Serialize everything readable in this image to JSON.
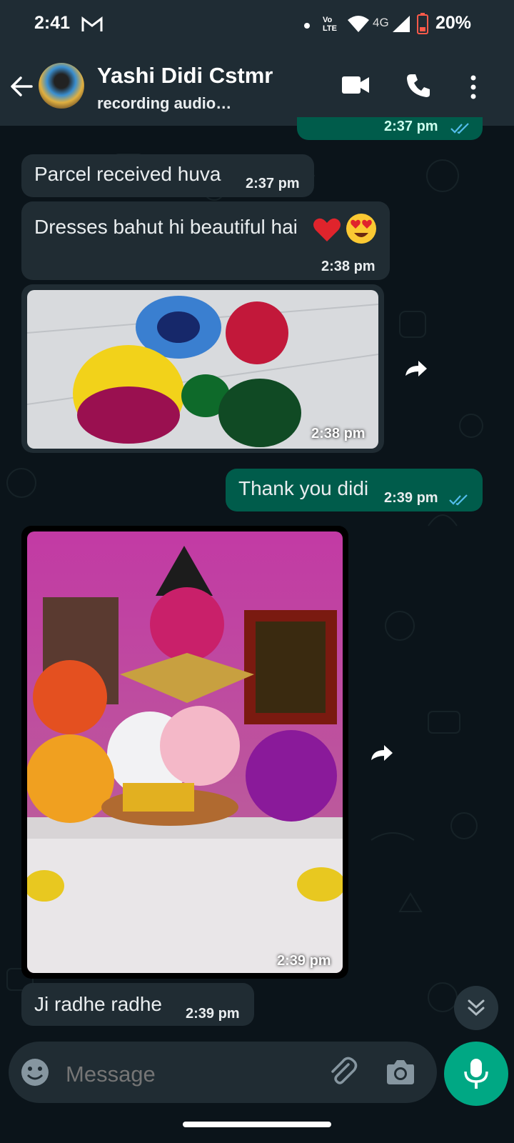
{
  "status_bar": {
    "time": "2:41",
    "battery": "20%",
    "network": "4G"
  },
  "header": {
    "contact_name": "Yashi Didi Cstmr",
    "status": "recording audio…"
  },
  "messages": [
    {
      "text": "Parcel received huva",
      "time": "2:37 pm"
    },
    {
      "text": "Dresses bahut hi beautiful hai",
      "time": "2:38 pm"
    },
    {
      "time": "2:38 pm"
    },
    {
      "text": "Thank you didi",
      "time": "2:39 pm"
    },
    {
      "time": "2:39 pm"
    },
    {
      "text": "Ji radhe radhe",
      "time": "2:39 pm"
    }
  ],
  "top_partial": {
    "time": "2:37 pm"
  },
  "composer": {
    "placeholder": "Message"
  },
  "colors": {
    "chat_bg": "#0b141a",
    "header_bg": "#1f2c34",
    "incoming": "#202c33",
    "outgoing": "#005c4b",
    "accent": "#00a884",
    "read_tick": "#53bdeb"
  }
}
